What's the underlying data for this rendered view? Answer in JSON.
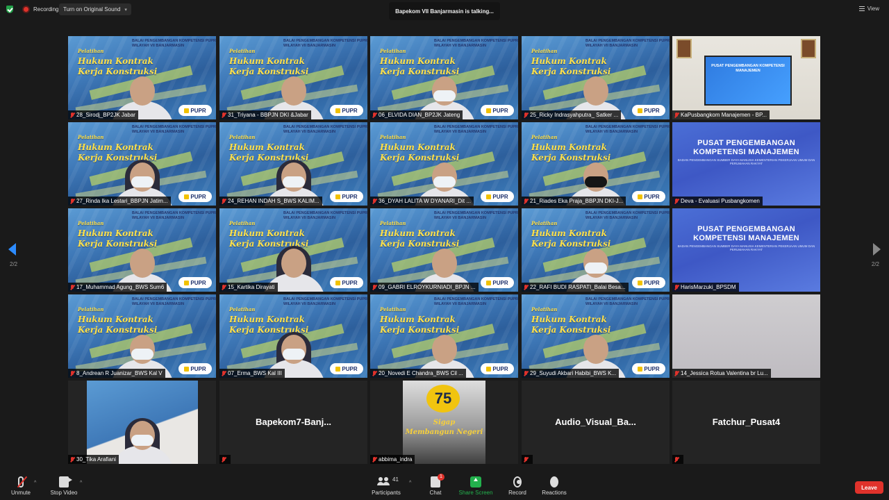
{
  "topbar": {
    "recording_label": "Recording",
    "original_sound_label": "Turn on Original Sound",
    "speaking_banner": "Bapekom VII Banjarmasin is talking...",
    "view_label": "View"
  },
  "pagination": {
    "left_page": "2/2",
    "right_page": "2/2"
  },
  "banner": {
    "script_title_1": "Pelatihan",
    "script_title_2": "Hukum Kontrak",
    "script_title_3": "Kerja Konstruksi",
    "header": "BALAI PENGEMBANGAN KOMPETENSI PUPR WILAYAH VII BANJARMASIN",
    "logo_text": "PUPR"
  },
  "pusat": {
    "title": "PUSAT PENGEMBANGAN KOMPETENSI MANAJEMEN",
    "subtitle": "BADAN PENGEMBANGAN SUMBER DAYA MANUSIA KEMENTERIAN PEKERJAAN UMUM DAN PERUMAHAN RAKYAT"
  },
  "poster": {
    "number": "75",
    "slogan_1": "Sigap",
    "slogan_2": "Membangun Negeri"
  },
  "tiles": [
    {
      "name": "28_Sirodj_BP2JK Jabar"
    },
    {
      "name": "31_Triyana - BBPJN DKI &Jabar"
    },
    {
      "name": "06_ELVIDA DIAN_BP2JK Jateng"
    },
    {
      "name": "25_Ricky Indrasyahputra_ Satker ..."
    },
    {
      "name": "KaPusbangkom Manajemen - BP..."
    },
    {
      "name": "27_Rinda Ika Lestari_BBPJN Jatim..."
    },
    {
      "name": "24_REHAN INDAH S_BWS KALIM..."
    },
    {
      "name": "36_DYAH LALITA W DYANARI_Dit ..."
    },
    {
      "name": "21_Riades Eka Praja_BBPJN DKI-J..."
    },
    {
      "name": "Deva - Evaluasi Pusbangkomen"
    },
    {
      "name": "17_Muhammad Agung_BWS Sum6"
    },
    {
      "name": "15_Kartika Dirayati"
    },
    {
      "name": "09_GABRI ELROYKURNIADI_BPJN ..."
    },
    {
      "name": "22_RAFI BUDI RASPATI_Balai Besa..."
    },
    {
      "name": "HarisMarzuki_BPSDM"
    },
    {
      "name": "8_Andrean R Juanizar_BWS Kal V"
    },
    {
      "name": "07_Erma_BWS Kal III"
    },
    {
      "name": "20_Novedi E Chandra_BWS Cil ..."
    },
    {
      "name": "29_Suyudi Akbari Habibi_BWS K..."
    },
    {
      "name": "14_Jessica Rotua Valentina br Lu..."
    },
    {
      "name": "30_Tika Arafiani"
    },
    {
      "name": "",
      "display_name": "Bapekom7-Banj..."
    },
    {
      "name": "abbima_indra"
    },
    {
      "name": "",
      "display_name": "Audio_Visual_Ba..."
    },
    {
      "name": "",
      "display_name": "Fatchur_Pusat4"
    }
  ],
  "toolbar": {
    "unmute": "Unmute",
    "stop_video": "Stop Video",
    "participants": "Participants",
    "participants_count": "41",
    "chat": "Chat",
    "chat_badge": "1",
    "share_screen": "Share Screen",
    "record": "Record",
    "reactions": "Reactions",
    "leave": "Leave"
  },
  "colors": {
    "accent_blue": "#2d8cff",
    "share_green": "#23b14d",
    "leave_red": "#e0322b"
  }
}
